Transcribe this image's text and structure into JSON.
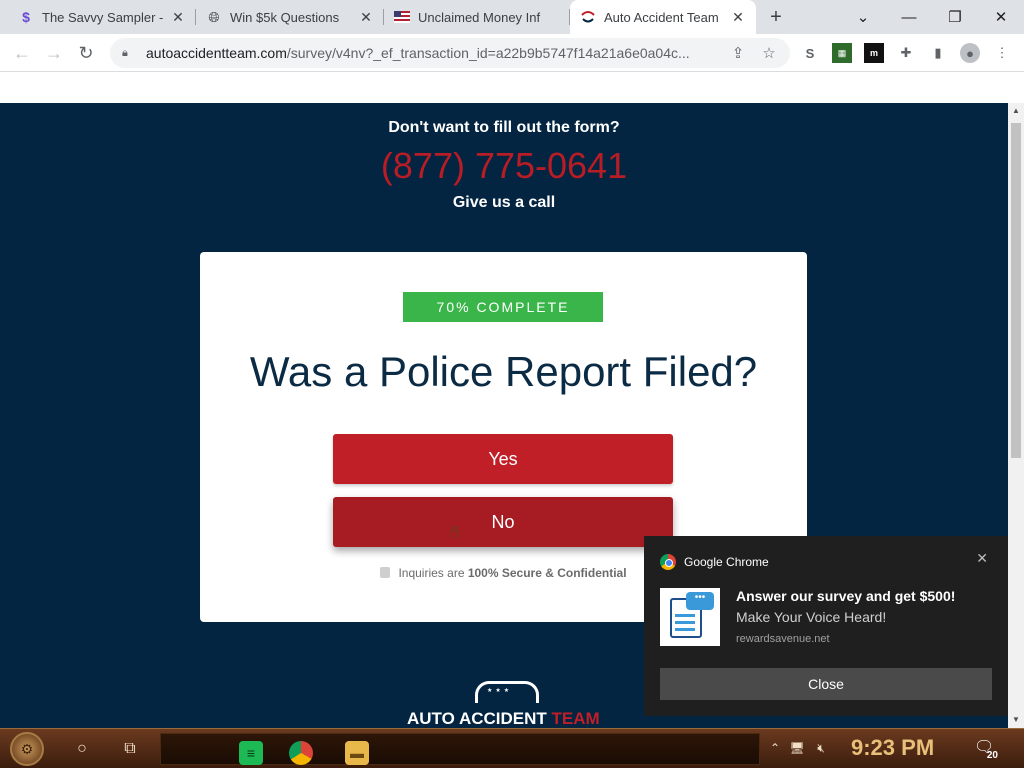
{
  "browser": {
    "tabs": [
      {
        "title": "The Savvy Sampler -",
        "favicon": "dollar-s-icon",
        "active": false
      },
      {
        "title": "Win $5k Questions",
        "favicon": "globe-icon",
        "active": false
      },
      {
        "title": "Unclaimed Money Inf",
        "favicon": "us-flag-icon",
        "active": false
      },
      {
        "title": "Auto Accident Team",
        "favicon": "smile-arc-icon",
        "active": true
      }
    ],
    "url_host": "autoaccidentteam.com",
    "url_rest": "/survey/v4nv?_ef_transaction_id=a22b9b5747f14a21a6e0a04c..."
  },
  "page": {
    "cta_question": "Don't want to fill out the form?",
    "cta_phone": "(877) 775-0641",
    "cta_sub": "Give us a call",
    "progress_label": "70% COMPLETE",
    "progress_value": 70,
    "question": "Was a Police Report Filed?",
    "answer_yes": "Yes",
    "answer_no": "No",
    "secure_prefix": "Inquiries are ",
    "secure_bold": "100% Secure & Confidential",
    "logo_text_main": "AUTO ACCIDENT ",
    "logo_text_accent": "TEAM"
  },
  "notification": {
    "app": "Google Chrome",
    "title": "Answer our survey and get $500!",
    "body": "Make Your Voice Heard!",
    "source": "rewardsavenue.net",
    "button": "Close"
  },
  "taskbar": {
    "clock": "9:23 PM",
    "notification_count": "20"
  },
  "colors": {
    "page_bg": "#032541",
    "accent_red": "#c11f27",
    "progress_green": "#3ab54a"
  }
}
